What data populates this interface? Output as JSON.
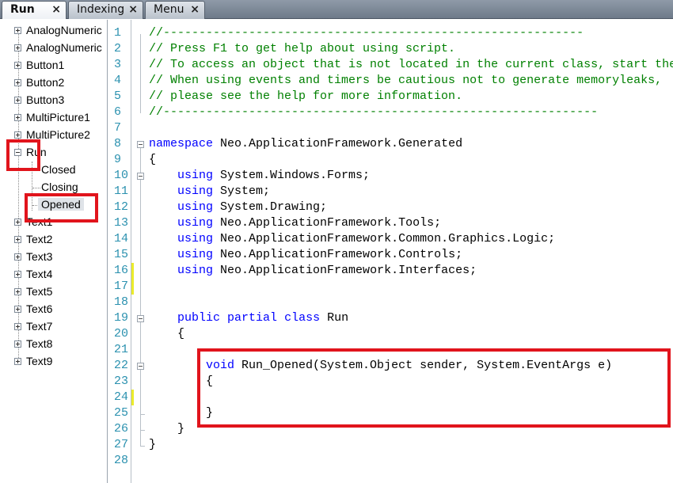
{
  "tabs": [
    {
      "label": "Run",
      "active": true
    },
    {
      "label": "Indexing",
      "active": false
    },
    {
      "label": "Menu",
      "active": false
    }
  ],
  "tab_close_glyph": "×",
  "tree": {
    "items": [
      {
        "label": "AnalogNumeric",
        "expander": "plus"
      },
      {
        "label": "AnalogNumeric",
        "expander": "plus"
      },
      {
        "label": "Button1",
        "expander": "plus"
      },
      {
        "label": "Button2",
        "expander": "plus"
      },
      {
        "label": "Button3",
        "expander": "plus"
      },
      {
        "label": "MultiPicture1",
        "expander": "plus"
      },
      {
        "label": "MultiPicture2",
        "expander": "plus"
      },
      {
        "label": "Run",
        "expander": "minus"
      },
      {
        "label": "Closed",
        "child": true
      },
      {
        "label": "Closing",
        "child": true
      },
      {
        "label": "Opened",
        "child": true,
        "selected": true
      },
      {
        "label": "Text1",
        "expander": "plus"
      },
      {
        "label": "Text2",
        "expander": "plus"
      },
      {
        "label": "Text3",
        "expander": "plus"
      },
      {
        "label": "Text4",
        "expander": "plus"
      },
      {
        "label": "Text5",
        "expander": "plus"
      },
      {
        "label": "Text6",
        "expander": "plus"
      },
      {
        "label": "Text7",
        "expander": "plus"
      },
      {
        "label": "Text8",
        "expander": "plus"
      },
      {
        "label": "Text9",
        "expander": "plus"
      }
    ]
  },
  "editor": {
    "line_numbers": [
      "1",
      "2",
      "3",
      "4",
      "5",
      "6",
      "7",
      "8",
      "9",
      "10",
      "11",
      "12",
      "13",
      "14",
      "15",
      "16",
      "17",
      "18",
      "19",
      "20",
      "21",
      "22",
      "23",
      "24",
      "25",
      "26",
      "27",
      "28"
    ],
    "lines": [
      [
        {
          "t": "//-----------------------------------------------------------",
          "c": "cmt"
        }
      ],
      [
        {
          "t": "// Press F1 to get help about using script.",
          "c": "cmt"
        }
      ],
      [
        {
          "t": "// To access an object that is not located in the current class, start the call with Globals.",
          "c": "cmt"
        }
      ],
      [
        {
          "t": "// When using events and timers be cautious not to generate memoryleaks,",
          "c": "cmt"
        }
      ],
      [
        {
          "t": "// please see the help for more information.",
          "c": "cmt"
        }
      ],
      [
        {
          "t": "//-------------------------------------------------------------",
          "c": "cmt"
        }
      ],
      [],
      [
        {
          "t": "namespace",
          "c": "kw"
        },
        {
          "t": " Neo.ApplicationFramework.Generated"
        }
      ],
      [
        {
          "t": "{"
        }
      ],
      [
        {
          "t": "    "
        },
        {
          "t": "using",
          "c": "kw"
        },
        {
          "t": " System.Windows.Forms;"
        }
      ],
      [
        {
          "t": "    "
        },
        {
          "t": "using",
          "c": "kw"
        },
        {
          "t": " System;"
        }
      ],
      [
        {
          "t": "    "
        },
        {
          "t": "using",
          "c": "kw"
        },
        {
          "t": " System.Drawing;"
        }
      ],
      [
        {
          "t": "    "
        },
        {
          "t": "using",
          "c": "kw"
        },
        {
          "t": " Neo.ApplicationFramework.Tools;"
        }
      ],
      [
        {
          "t": "    "
        },
        {
          "t": "using",
          "c": "kw"
        },
        {
          "t": " Neo.ApplicationFramework.Common.Graphics.Logic;"
        }
      ],
      [
        {
          "t": "    "
        },
        {
          "t": "using",
          "c": "kw"
        },
        {
          "t": " Neo.ApplicationFramework.Controls;"
        }
      ],
      [
        {
          "t": "    "
        },
        {
          "t": "using",
          "c": "kw"
        },
        {
          "t": " Neo.ApplicationFramework.Interfaces;"
        }
      ],
      [],
      [],
      [
        {
          "t": "    "
        },
        {
          "t": "public",
          "c": "kw"
        },
        {
          "t": " "
        },
        {
          "t": "partial",
          "c": "kw"
        },
        {
          "t": " "
        },
        {
          "t": "class",
          "c": "kw"
        },
        {
          "t": " Run"
        }
      ],
      [
        {
          "t": "    {"
        }
      ],
      [],
      [
        {
          "t": "        "
        },
        {
          "t": "void",
          "c": "kw"
        },
        {
          "t": " Run_Opened(System.Object sender, System.EventArgs e)"
        }
      ],
      [
        {
          "t": "        {"
        }
      ],
      [],
      [
        {
          "t": "        }"
        }
      ],
      [
        {
          "t": "    }"
        }
      ],
      [
        {
          "t": "}"
        }
      ],
      []
    ],
    "fold_markers_at_lines": [
      8,
      10,
      19,
      22
    ],
    "changed_lines": [
      16,
      17,
      24
    ]
  },
  "colors": {
    "comment": "#008000",
    "keyword": "#0000ff",
    "line_number": "#2b91af",
    "highlight_box": "#e1141c",
    "change_marker": "#ecec2a"
  }
}
